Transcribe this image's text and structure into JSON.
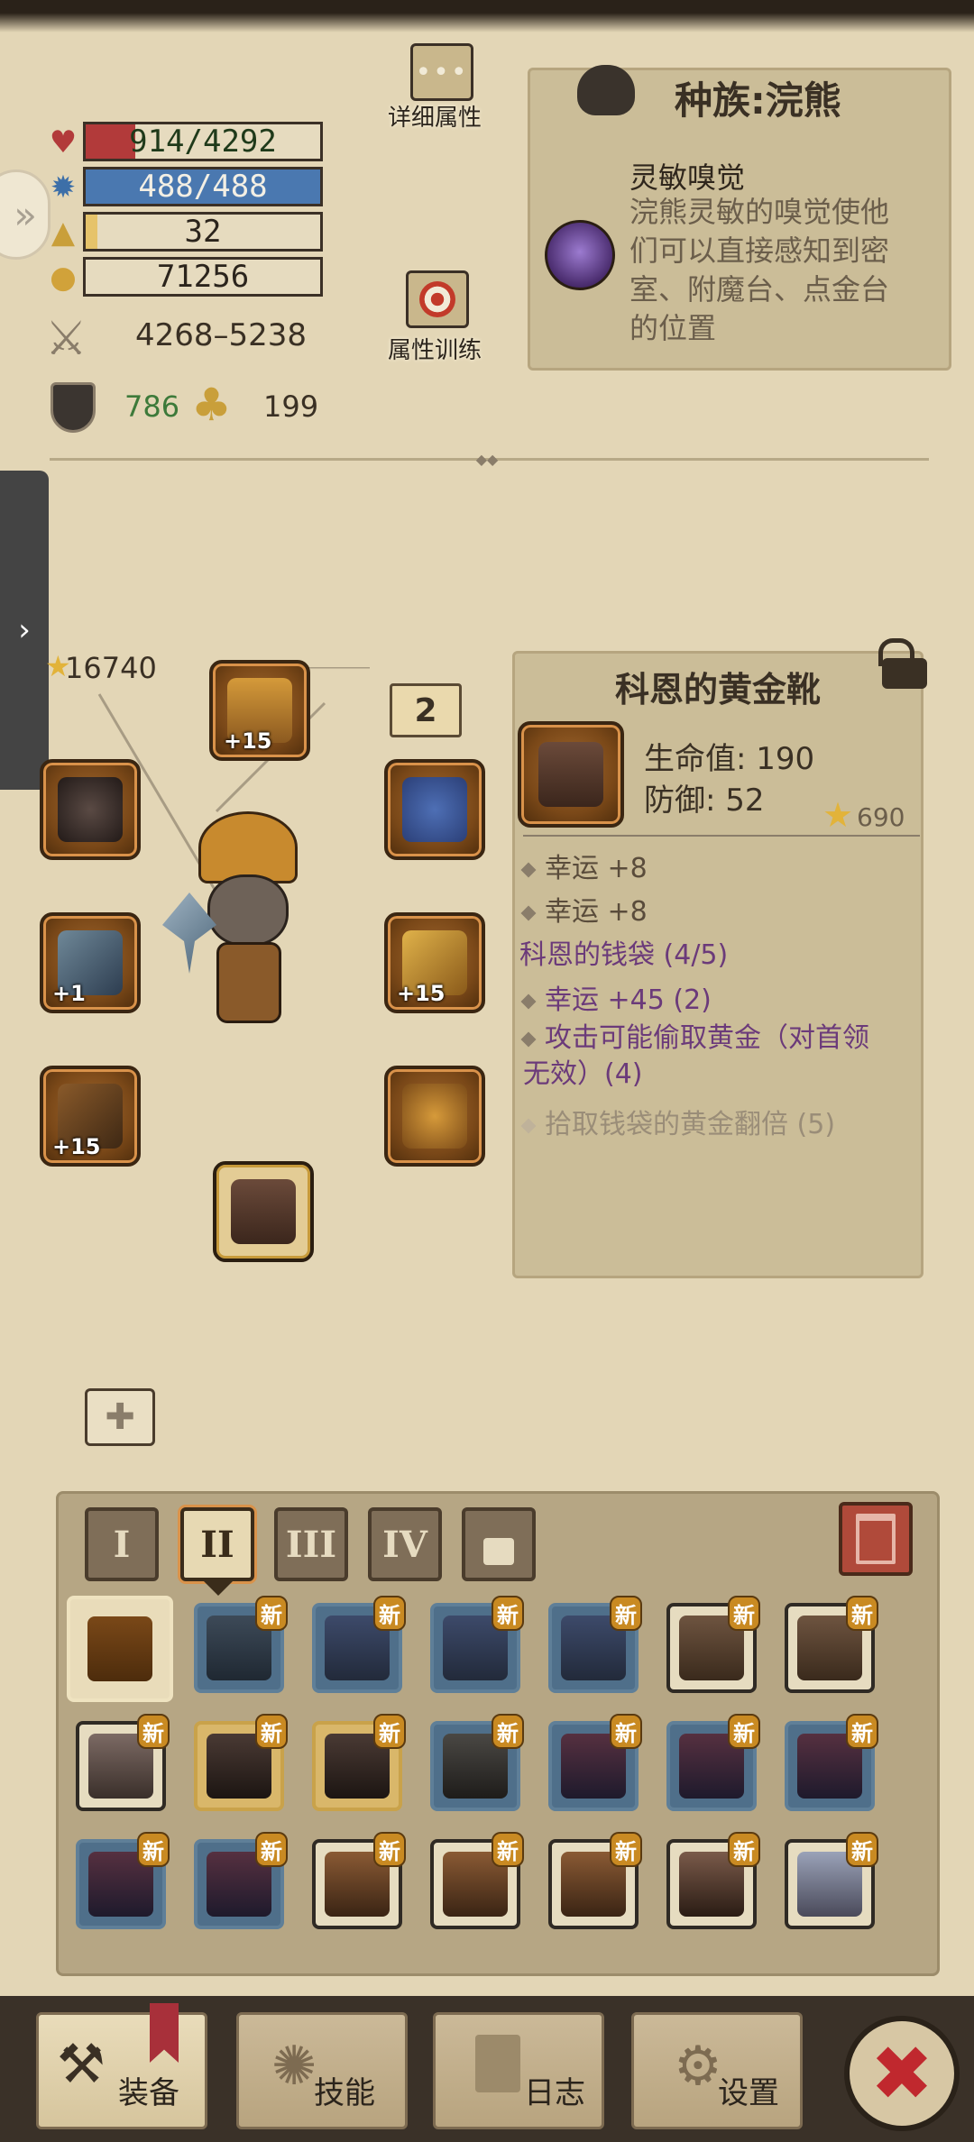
{
  "stats": {
    "hp": "914/4292",
    "hp_ratio": 0.213,
    "mp": "488/488",
    "mp_ratio": 1.0,
    "level": "32",
    "level_ratio": 0.05,
    "gold": "71256",
    "attack": "4268–5238",
    "defense": "786",
    "luck": "199"
  },
  "buttons": {
    "detail_attributes": "详细属性",
    "attribute_training": "属性训练"
  },
  "race": {
    "title": "种族:浣熊",
    "skill_name": "灵敏嗅觉",
    "skill_desc": "浣熊灵敏的嗅觉使他们可以直接感知到密室、附魔台、点金台的位置"
  },
  "equipment": {
    "power": "16740",
    "set_count": "2",
    "slot_levels": [
      "+15",
      "+1",
      "+15",
      "+15"
    ]
  },
  "item": {
    "name": "科恩的黄金靴",
    "stat1": "生命值: 190",
    "stat2": "防御: 52",
    "score": "690",
    "affix1": "幸运 +8",
    "affix2": "幸运 +8",
    "set_name": "科恩的钱袋 (4/5)",
    "set1": "幸运 +45 (2)",
    "set2": "攻击可能偷取黄金（对首领无效）(4)",
    "set3": "拾取钱袋的黄金翻倍 (5)"
  },
  "inventory": {
    "tabs": [
      "I",
      "II",
      "III",
      "IV"
    ],
    "new_label": "新"
  },
  "nav": {
    "equip": "装备",
    "skills": "技能",
    "log": "日志",
    "settings": "设置"
  },
  "colors": {
    "hp": "#b23a3a",
    "mp": "#4a78b0",
    "xp": "#e6c36a",
    "rare_border": "#5f7f98",
    "gold_border": "#c9a24a"
  }
}
